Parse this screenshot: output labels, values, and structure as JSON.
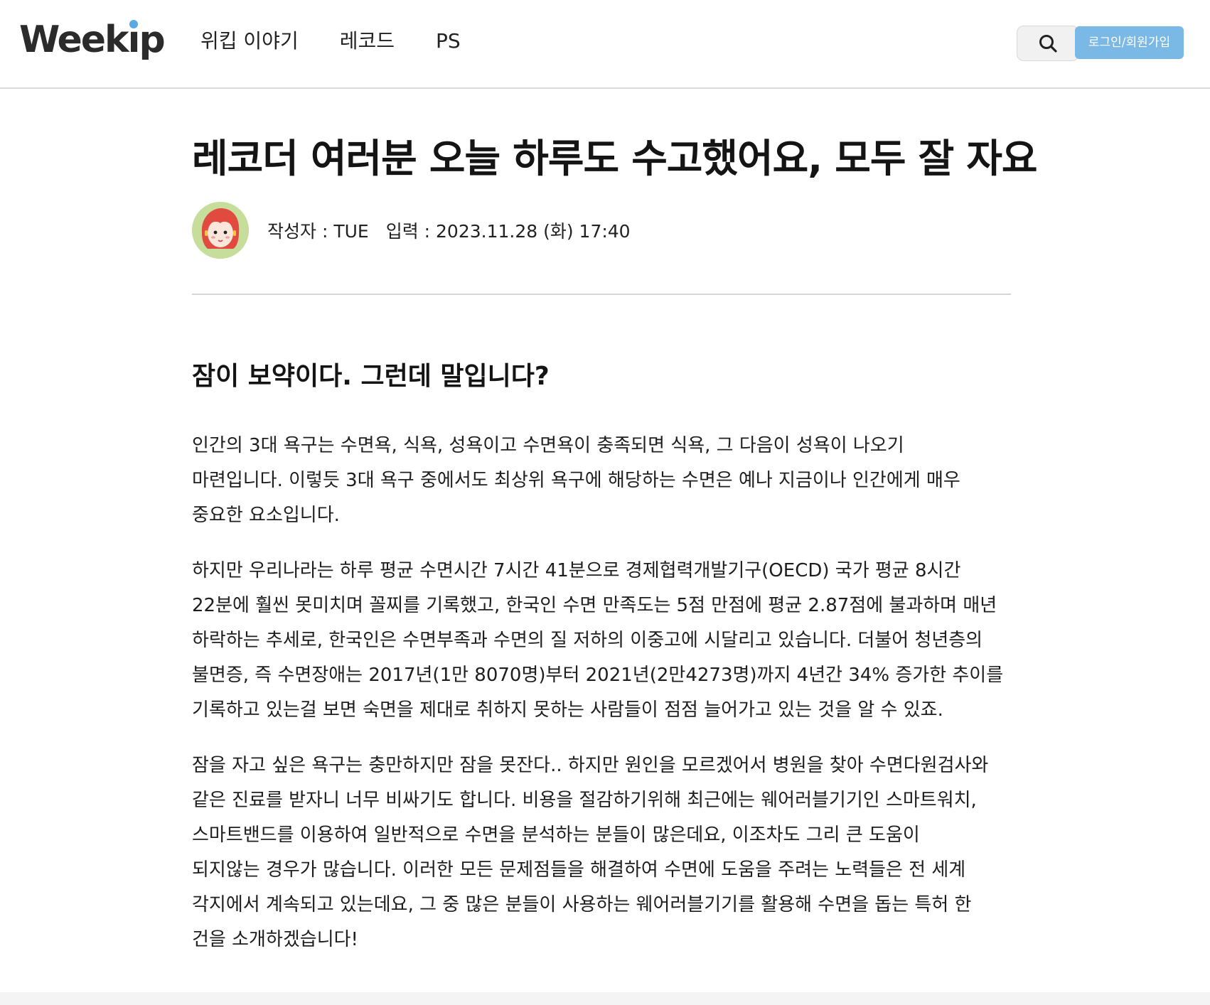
{
  "header": {
    "logo": "Weekip",
    "nav": [
      "위킵 이야기",
      "레코드",
      "PS"
    ],
    "search_icon": "search-icon",
    "login_label": "로그인/회원가입",
    "accent": "#7ab8e6"
  },
  "article": {
    "title": "레코더 여러분 오늘 하루도 수고했어요, 모두 잘 자요",
    "author": "작성자 : TUE",
    "date": "입력 : 2023.11.28 (화) 17:40",
    "subtitle": "잠이 보약이다. 그런데 말입니다?",
    "paragraphs": [
      [
        " 인간의 3대 욕구는 수면욕, 식욕, 성욕이고 수면욕이 충족되면 식욕, 그 다음이 성욕이 나오기",
        "마련입니다. 이렇듯 3대 욕구 중에서도 최상위 욕구에 해당하는 수면은 예나 지금이나 인간에게 매우",
        "중요한 요소입니다."
      ],
      [
        " 하지만 우리나라는 하루 평균 수면시간 7시간 41분으로 경제협력개발기구(OECD) 국가 평균 8시간",
        "22분에 훨씬 못미치며 꼴찌를 기록했고, 한국인 수면 만족도는 5점 만점에 평균 2.87점에 불과하며 매년",
        "하락하는 추세로, 한국인은 수면부족과 수면의 질 저하의 이중고에 시달리고 있습니다. 더불어 청년층의",
        "불면증, 즉 수면장애는 2017년(1만 8070명)부터 2021년(2만4273명)까지 4년간 34% 증가한 추이를",
        "기록하고 있는걸 보면 숙면을 제대로 취하지 못하는 사람들이 점점 늘어가고 있는 것을 알 수 있죠."
      ],
      [
        " 잠을 자고 싶은 욕구는 충만하지만 잠을 못잔다.. 하지만 원인을 모르겠어서 병원을 찾아 수면다원검사와",
        "같은 진료를 받자니 너무 비싸기도 합니다. 비용을 절감하기위해 최근에는 웨어러블기기인 스마트워치,",
        "스마트밴드를 이용하여 일반적으로 수면을 분석하는 분들이 많은데요, 이조차도 그리 큰 도움이",
        "되지않는 경우가 많습니다. 이러한 모든 문제점들을 해결하여 수면에 도움을 주려는 노력들은 전 세계",
        "각지에서 계속되고 있는데요, 그 중 많은 분들이 사용하는 웨어러블기기를 활용해 수면을 돕는 특허 한",
        "건을 소개하겠습니다!"
      ]
    ]
  }
}
